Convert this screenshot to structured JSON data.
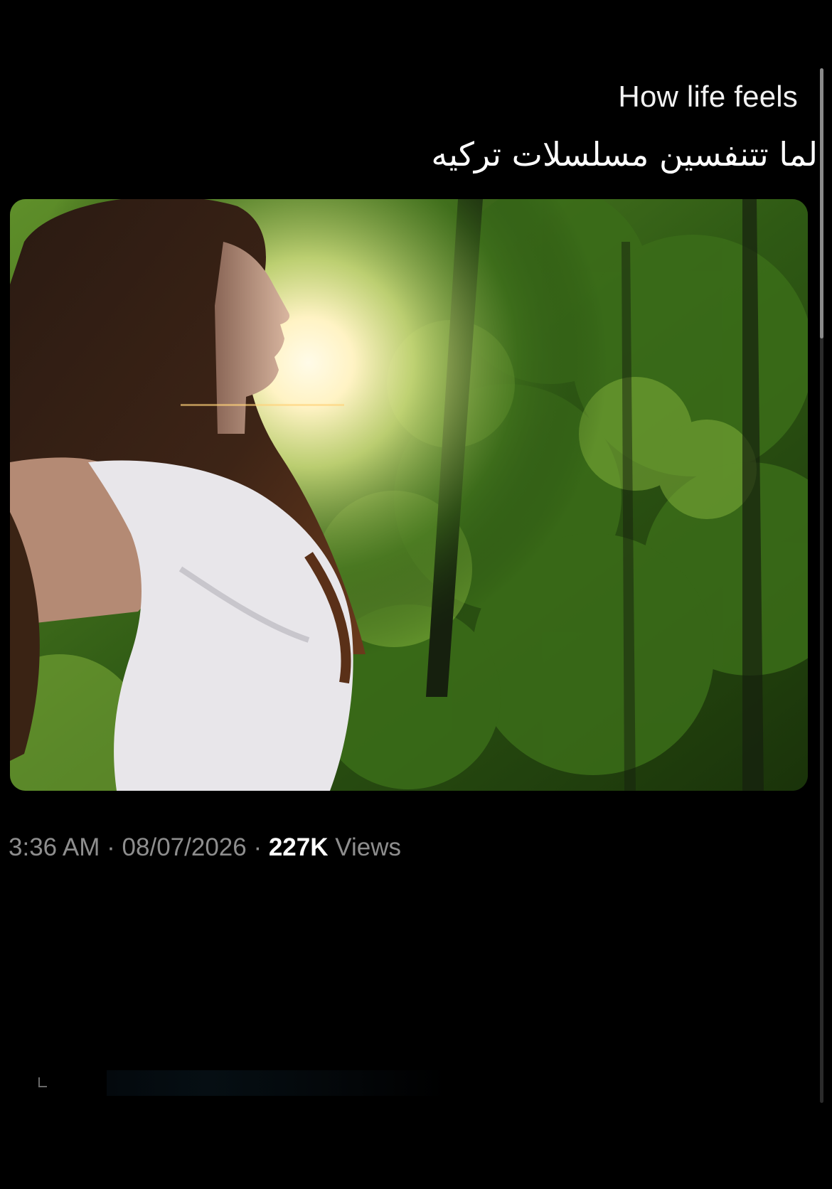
{
  "post": {
    "caption_en": "How life feels",
    "caption_ar": "لما تتنفسين مسلسلات تركيه",
    "image_alt": "woman breathing in sunlight in a forest"
  },
  "meta": {
    "time": "3:36 AM",
    "separator": "·",
    "date": "08/07/2026",
    "views_count": "227K",
    "views_label": "Views"
  },
  "colors": {
    "background": "#000000",
    "meta_text": "#8e8e8e",
    "caption_text": "#f2f2f2"
  }
}
